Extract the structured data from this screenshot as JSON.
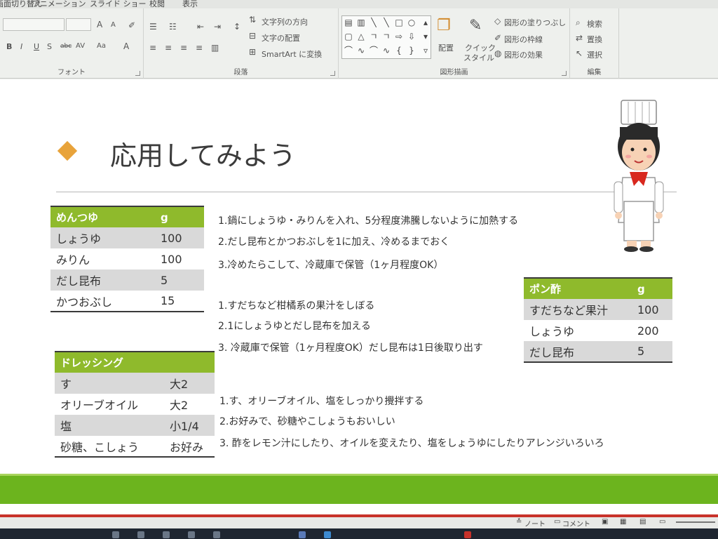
{
  "ribbon": {
    "tabs": [
      "画面切り替え",
      "アニメーション",
      "スライド ショー",
      "校閲",
      "表示"
    ],
    "font_group": {
      "label": "フォント",
      "buttons": [
        "B",
        "I",
        "U",
        "S",
        "abc",
        "AV",
        "Aa",
        "A"
      ],
      "size_buttons": [
        "A",
        "A"
      ]
    },
    "paragraph_group": {
      "label": "段落",
      "text_direction": "文字列の方向",
      "text_align": "文字の配置",
      "smartart": "SmartArt に変換"
    },
    "drawing_group": {
      "label": "図形描画",
      "arrange": "配置",
      "quick_style_line1": "クイック",
      "quick_style_line2": "スタイル",
      "shape_fill": "図形の塗りつぶし",
      "shape_outline": "図形の枠線",
      "shape_effects": "図形の効果"
    },
    "editing_group": {
      "label": "編集",
      "find": "検索",
      "replace": "置換",
      "select": "選択"
    }
  },
  "slide": {
    "title": "応用してみよう",
    "mentsuyu": {
      "header": [
        "めんつゆ",
        "g"
      ],
      "rows": [
        [
          "しょうゆ",
          "100"
        ],
        [
          "みりん",
          "100"
        ],
        [
          "だし昆布",
          "5"
        ],
        [
          "かつおぶし",
          "15"
        ]
      ]
    },
    "mentsuyu_steps": [
      "1.鍋にしょうゆ・みりんを入れ、5分程度沸騰しないように加熱する",
      "2.だし昆布とかつおぶしを1に加え、冷めるまでおく",
      "3.冷めたらこして、冷蔵庫で保管（1ヶ月程度OK）"
    ],
    "ponzu": {
      "header": [
        "ポン酢",
        "g"
      ],
      "rows": [
        [
          "すだちなど果汁",
          "100"
        ],
        [
          "しょうゆ",
          "200"
        ],
        [
          "だし昆布",
          "5"
        ]
      ]
    },
    "ponzu_steps": [
      "1.すだちなど柑橘系の果汁をしぼる",
      "2.1にしょうゆとだし昆布を加える",
      "3. 冷蔵庫で保管（1ヶ月程度OK）だし昆布は1日後取り出す"
    ],
    "dressing": {
      "header": [
        "ドレッシング",
        ""
      ],
      "rows": [
        [
          "す",
          "大2"
        ],
        [
          "オリーブオイル",
          "大2"
        ],
        [
          "塩",
          "小1/4"
        ],
        [
          "砂糖、こしょう",
          "お好み"
        ]
      ]
    },
    "dressing_steps": [
      "1.す、オリーブオイル、塩をしっかり攪拌する",
      "2.お好みで、砂糖やこしょうもおいしい",
      "3. 酢をレモン汁にしたり、オイルを変えたり、塩をしょうゆにしたりアレンジいろいろ"
    ]
  },
  "statusbar": {
    "notes": "ノート",
    "comments": "コメント"
  },
  "colors": {
    "accent_green": "#8fba2c",
    "band_green": "#6cb41e",
    "diamond_orange": "#e8a33a",
    "status_red": "#c8322a"
  }
}
